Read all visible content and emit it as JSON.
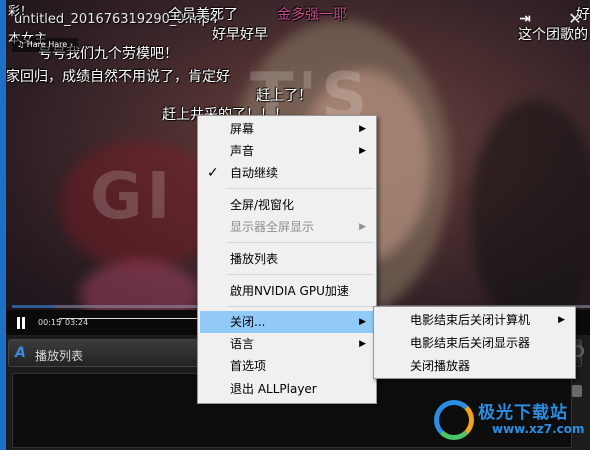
{
  "window": {
    "filename": "untitled_201676319290_0.mp4",
    "pin_icon": "pin-icon",
    "close_icon": "close-icon"
  },
  "video": {
    "hare_badge": "♫ Hare Hare ›",
    "background_letters": [
      "T'S",
      "GI"
    ],
    "danmaku": [
      "彩！",
      "全员美死了",
      "金多强一耶",
      "好",
      "本女主",
      "好早好早",
      "这个团歌的",
      "号号我们九个劳模吧！",
      "家回归，成绩自然不用说了，肯定好",
      "赶上了！",
      "赶上井采的了！！！"
    ]
  },
  "controls": {
    "current_time": "00:15",
    "separator": "/",
    "total_time": "03:24",
    "progress": 0.074
  },
  "playlist": {
    "logo": "A",
    "title": "播放列表"
  },
  "context_menu": {
    "items": [
      {
        "label": "屏幕",
        "submenu": true
      },
      {
        "label": "声音",
        "submenu": true
      },
      {
        "label": "自动继续",
        "checked": true
      },
      {
        "label": "全屏/视窗化"
      },
      {
        "label": "显示器全屏显示",
        "submenu": true,
        "disabled": true
      },
      {
        "label": "播放列表"
      },
      {
        "label": "啟用NVIDIA GPU加速"
      },
      {
        "label": "关闭...",
        "submenu": true,
        "highlighted": true
      },
      {
        "label": "语言",
        "submenu": true
      },
      {
        "label": "首选项"
      },
      {
        "label": "退出 ALLPlayer"
      }
    ],
    "arrow_glyph": "▶",
    "check_glyph": "✓"
  },
  "close_submenu": {
    "items": [
      {
        "label": "电影结束后关闭计算机",
        "submenu": true
      },
      {
        "label": "电影结束后关闭显示器"
      },
      {
        "label": "关闭播放器"
      }
    ]
  },
  "watermark": {
    "name": "极光下载站",
    "url": "www.xz7.com"
  },
  "colors": {
    "menu_bg": "#f0f0f0",
    "menu_highlight": "#91c9f7",
    "disabled_text": "#8f8f8f",
    "watermark_blue": "#2a8de0"
  }
}
